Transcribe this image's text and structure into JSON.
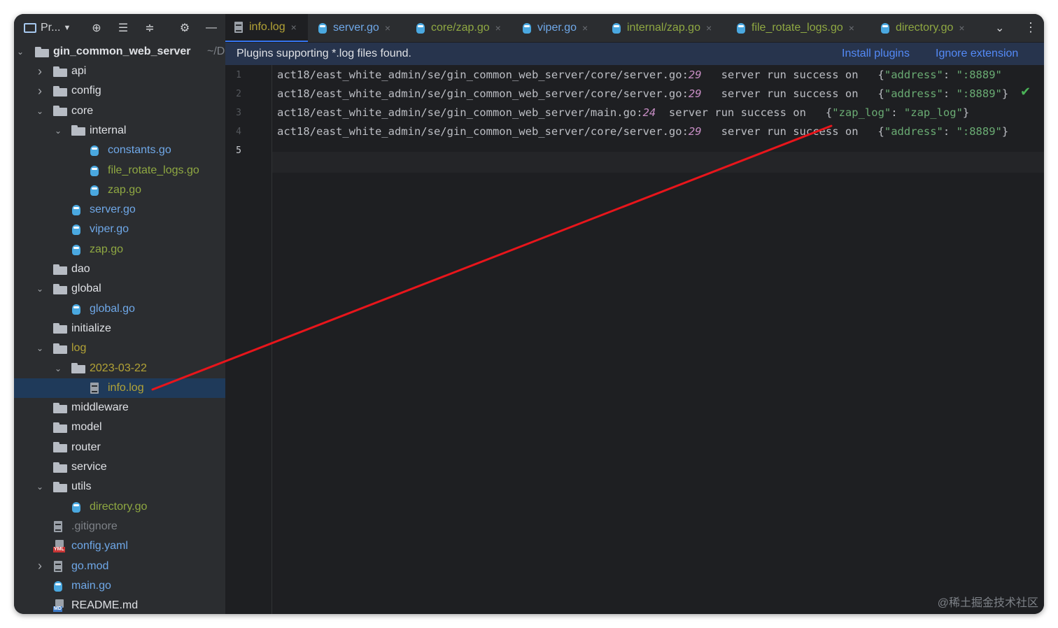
{
  "sidebar": {
    "project_label": "Pr...",
    "root": {
      "name": "gin_common_web_server",
      "path": "~/D"
    },
    "items": [
      {
        "label": "api",
        "type": "folder",
        "color": "def",
        "expand": "collapsed",
        "indent": 1
      },
      {
        "label": "config",
        "type": "folder",
        "color": "def",
        "expand": "collapsed",
        "indent": 1
      },
      {
        "label": "core",
        "type": "folder",
        "color": "def",
        "expand": "expanded",
        "indent": 1
      },
      {
        "label": "internal",
        "type": "folder",
        "color": "def",
        "expand": "expanded",
        "indent": 2
      },
      {
        "label": "constants.go",
        "type": "go",
        "color": "blue",
        "indent": 3
      },
      {
        "label": "file_rotate_logs.go",
        "type": "go",
        "color": "green",
        "indent": 3
      },
      {
        "label": "zap.go",
        "type": "go",
        "color": "green",
        "indent": 3
      },
      {
        "label": "server.go",
        "type": "go",
        "color": "blue",
        "indent": 2
      },
      {
        "label": "viper.go",
        "type": "go",
        "color": "blue",
        "indent": 2
      },
      {
        "label": "zap.go",
        "type": "go",
        "color": "green",
        "indent": 2
      },
      {
        "label": "dao",
        "type": "folder",
        "color": "def",
        "indent": 1
      },
      {
        "label": "global",
        "type": "folder",
        "color": "def",
        "expand": "expanded",
        "indent": 1
      },
      {
        "label": "global.go",
        "type": "go",
        "color": "blue",
        "indent": 2
      },
      {
        "label": "initialize",
        "type": "folder",
        "color": "def",
        "indent": 1
      },
      {
        "label": "log",
        "type": "folder",
        "color": "olive",
        "expand": "expanded",
        "indent": 1
      },
      {
        "label": "2023-03-22",
        "type": "folder",
        "color": "olive",
        "expand": "expanded",
        "indent": 2
      },
      {
        "label": "info.log",
        "type": "doc",
        "color": "olive",
        "indent": 3,
        "selected": true
      },
      {
        "label": "middleware",
        "type": "folder",
        "color": "def",
        "indent": 1
      },
      {
        "label": "model",
        "type": "folder",
        "color": "def",
        "indent": 1
      },
      {
        "label": "router",
        "type": "folder",
        "color": "def",
        "indent": 1
      },
      {
        "label": "service",
        "type": "folder",
        "color": "def",
        "indent": 1
      },
      {
        "label": "utils",
        "type": "folder",
        "color": "def",
        "expand": "expanded",
        "indent": 1
      },
      {
        "label": "directory.go",
        "type": "go",
        "color": "green",
        "indent": 2
      },
      {
        "label": ".gitignore",
        "type": "doc",
        "color": "gray",
        "indent": 1
      },
      {
        "label": "config.yaml",
        "type": "yml",
        "tag": "YML",
        "color": "blue",
        "indent": 1
      },
      {
        "label": "go.mod",
        "type": "doc",
        "color": "blue",
        "expand": "collapsed",
        "indent": 1
      },
      {
        "label": "main.go",
        "type": "go",
        "color": "blue",
        "indent": 1
      },
      {
        "label": "README.md",
        "type": "yml",
        "tag": "MD",
        "color": "def",
        "indent": 1
      }
    ]
  },
  "tabs": [
    {
      "label": "info.log",
      "type": "doc",
      "color": "olive",
      "active": true
    },
    {
      "label": "server.go",
      "type": "go",
      "color": "blue"
    },
    {
      "label": "core/zap.go",
      "type": "go",
      "color": "green"
    },
    {
      "label": "viper.go",
      "type": "go",
      "color": "blue"
    },
    {
      "label": "internal/zap.go",
      "type": "go",
      "color": "green"
    },
    {
      "label": "file_rotate_logs.go",
      "type": "go",
      "color": "green"
    },
    {
      "label": "directory.go",
      "type": "go",
      "color": "green"
    }
  ],
  "banner": {
    "message": "Plugins supporting *.log files found.",
    "install": "Install plugins",
    "ignore": "Ignore extension"
  },
  "editor": {
    "line_numbers": [
      "1",
      "2",
      "3",
      "4",
      "5"
    ],
    "lines": [
      {
        "path": "act18/east_white_admin/se/gin_common_web_server/core/server.go:",
        "num": "29",
        "msg": "   server run success on   ",
        "obj": [
          {
            "t": "p",
            "v": "{"
          },
          {
            "t": "s",
            "v": "\"address\""
          },
          {
            "t": "p",
            "v": ": "
          },
          {
            "t": "s",
            "v": "\":8889\""
          }
        ]
      },
      {
        "path": "act18/east_white_admin/se/gin_common_web_server/core/server.go:",
        "num": "29",
        "msg": "   server run success on   ",
        "obj": [
          {
            "t": "p",
            "v": "{"
          },
          {
            "t": "s",
            "v": "\"address\""
          },
          {
            "t": "p",
            "v": ": "
          },
          {
            "t": "s",
            "v": "\":8889\""
          },
          {
            "t": "p",
            "v": "}"
          }
        ]
      },
      {
        "path": "act18/east_white_admin/se/gin_common_web_server/main.go:",
        "num": "24",
        "msg": "  server run success on   ",
        "obj": [
          {
            "t": "p",
            "v": "{"
          },
          {
            "t": "s",
            "v": "\"zap_log\""
          },
          {
            "t": "p",
            "v": ": "
          },
          {
            "t": "s",
            "v": "\"zap_log\""
          },
          {
            "t": "p",
            "v": "}"
          }
        ]
      },
      {
        "path": "act18/east_white_admin/se/gin_common_web_server/core/server.go:",
        "num": "29",
        "msg": "   server run success on   ",
        "obj": [
          {
            "t": "p",
            "v": "{"
          },
          {
            "t": "s",
            "v": "\"address\""
          },
          {
            "t": "p",
            "v": ": "
          },
          {
            "t": "s",
            "v": "\":8889\""
          },
          {
            "t": "p",
            "v": "}"
          }
        ]
      }
    ]
  },
  "watermark": "@稀土掘金技术社区",
  "colors": {
    "accent": "#3574f0",
    "annotation_arrow": "#e8151b",
    "selection": "#1f3a5a"
  }
}
